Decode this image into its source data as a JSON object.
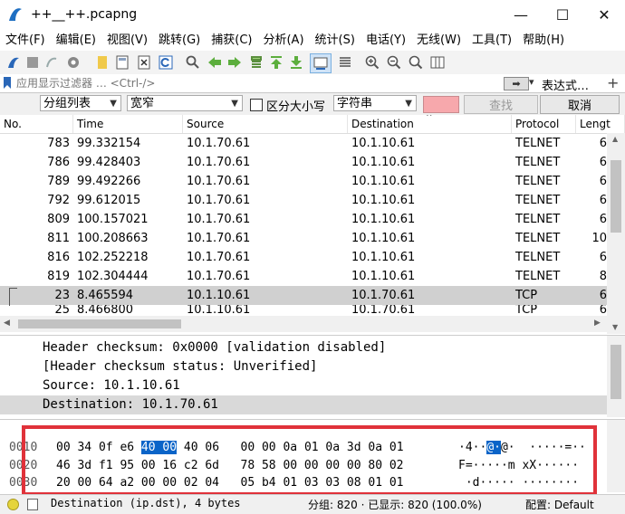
{
  "window": {
    "title": "++__++.pcapng",
    "minimize": "—",
    "maximize": "☐",
    "close": "✕"
  },
  "menu": [
    "文件(F)",
    "编辑(E)",
    "视图(V)",
    "跳转(G)",
    "捕获(C)",
    "分析(A)",
    "统计(S)",
    "电话(Y)",
    "无线(W)",
    "工具(T)",
    "帮助(H)"
  ],
  "filter": {
    "placeholder": "应用显示过滤器 … <Ctrl-/>",
    "expression_label": "表达式…",
    "arrow": "➡",
    "plus": "+"
  },
  "search": {
    "scope": "分组列表",
    "mode": "宽窄",
    "case_label": "区分大小写",
    "type": "字符串",
    "find_label": "查找",
    "cancel_label": "取消"
  },
  "packet_list": {
    "columns": [
      "No.",
      "Time",
      "Source",
      "Destination",
      "Protocol",
      "Lengt"
    ],
    "rows": [
      {
        "no": "783",
        "time": "99.332154",
        "src": "10.1.70.61",
        "dst": "10.1.10.61",
        "proto": "TELNET",
        "len": "6"
      },
      {
        "no": "786",
        "time": "99.428403",
        "src": "10.1.70.61",
        "dst": "10.1.10.61",
        "proto": "TELNET",
        "len": "6"
      },
      {
        "no": "789",
        "time": "99.492266",
        "src": "10.1.70.61",
        "dst": "10.1.10.61",
        "proto": "TELNET",
        "len": "6"
      },
      {
        "no": "792",
        "time": "99.612015",
        "src": "10.1.70.61",
        "dst": "10.1.10.61",
        "proto": "TELNET",
        "len": "6"
      },
      {
        "no": "809",
        "time": "100.157021",
        "src": "10.1.70.61",
        "dst": "10.1.10.61",
        "proto": "TELNET",
        "len": "6"
      },
      {
        "no": "811",
        "time": "100.208663",
        "src": "10.1.70.61",
        "dst": "10.1.10.61",
        "proto": "TELNET",
        "len": "10"
      },
      {
        "no": "816",
        "time": "102.252218",
        "src": "10.1.70.61",
        "dst": "10.1.10.61",
        "proto": "TELNET",
        "len": "6"
      },
      {
        "no": "819",
        "time": "102.304444",
        "src": "10.1.70.61",
        "dst": "10.1.10.61",
        "proto": "TELNET",
        "len": "8"
      },
      {
        "no": "23",
        "time": "8.465594",
        "src": "10.1.10.61",
        "dst": "10.1.70.61",
        "proto": "TCP",
        "len": "6"
      },
      {
        "no": "25",
        "time": "8.466800",
        "src": "10.1.10.61",
        "dst": "10.1.70.61",
        "proto": "TCP",
        "len": "6"
      }
    ]
  },
  "details": [
    "Header checksum: 0x0000 [validation disabled]",
    "[Header checksum status: Unverified]",
    "Source: 10.1.10.61",
    "Destination: 10.1.70.61"
  ],
  "hex": [
    {
      "offset": "0010",
      "a": "00 34 0f e6 ",
      "h": "40 00",
      "b": " 40 06   00 00 0a 01 0a 3d 0a 01",
      "asc_a": "·4··",
      "asc_h": "@·",
      "asc_b": "@·  ·····=··"
    },
    {
      "offset": "0020",
      "a": "46 3d f1 95 00 16 c2 6d   78 58 00 00 00 00 80 02",
      "h": "",
      "b": "",
      "asc_a": "F=·····m xX······",
      "asc_h": "",
      "asc_b": ""
    },
    {
      "offset": "0030",
      "a": "20 00 64 a2 00 00 02 04   05 b4 01 03 03 08 01 01",
      "h": "",
      "b": "",
      "asc_a": " ·d····· ········",
      "asc_h": "",
      "asc_b": ""
    }
  ],
  "status": {
    "field": "Destination (ip.dst), 4 bytes",
    "packets": "分组: 820 · 已显示: 820 (100.0%)",
    "profile": "配置: Default"
  },
  "colors": {
    "selection": "#0a64c8",
    "highlight_box": "#e0323a",
    "search_text_bg": "#f7a8ac"
  }
}
